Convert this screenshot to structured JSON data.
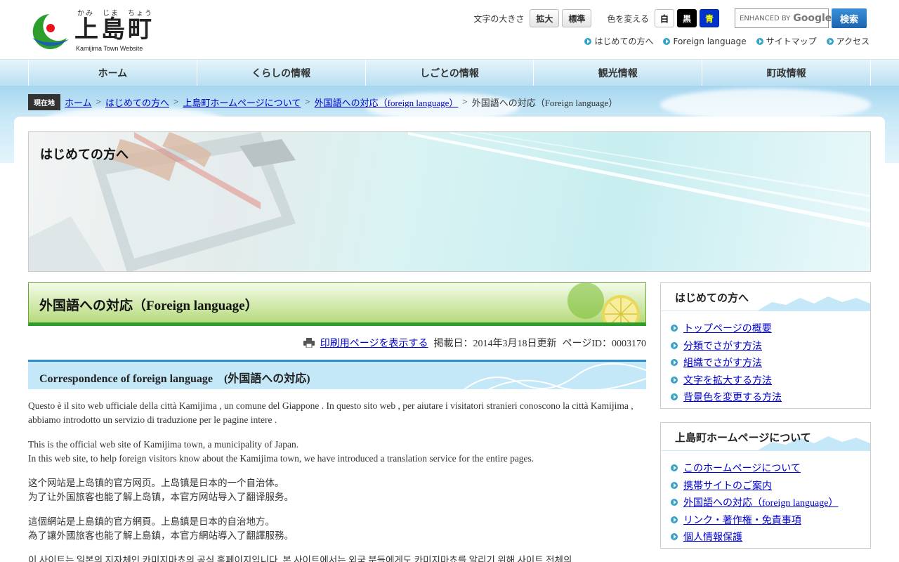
{
  "logo": {
    "ruby": "かみ　じま　ちょう",
    "name": "上島町",
    "subtitle": "Kamijima Town Website"
  },
  "tools": {
    "font_size_label": "文字の大きさ",
    "enlarge": "拡大",
    "standard": "標準",
    "color_label": "色を変える",
    "white": "白",
    "black": "黒",
    "blue": "青",
    "search_enhanced": "ENHANCED BY",
    "search_brand": "Google",
    "search_button": "検索"
  },
  "util_links": [
    "はじめての方へ",
    "Foreign language",
    "サイトマップ",
    "アクセス"
  ],
  "nav": [
    "ホーム",
    "くらしの情報",
    "しごとの情報",
    "観光情報",
    "町政情報"
  ],
  "breadcrumb": {
    "badge": "現在地",
    "links": [
      "ホーム",
      "はじめての方へ",
      "上島町ホームページについて",
      "外国語への対応（foreign language）"
    ],
    "separator": ">",
    "current": "外国語への対応（Foreign language）"
  },
  "hero": {
    "title": "はじめての方へ"
  },
  "page": {
    "title": "外国語への対応（Foreign language）",
    "print_link": "印刷用ページを表示する",
    "posted": "掲載日：2014年3月18日更新",
    "page_id": "ページID：0003170",
    "section_heading": "Correspondence of foreign language　(外国語への対応)",
    "paragraphs": [
      [
        "Questo è il sito web ufficiale della città Kamijima , un comune del Giappone . In questo sito web , per aiutare i visitatori stranieri conoscono la città Kamijima , abbiamo introdotto un servizio di traduzione per le pagine intere ."
      ],
      [
        "This is the official web site of Kamijima town, a municipality of Japan.",
        "In this web site, to help foreign visitors know about the Kamijima town, we have introduced a translation service for the entire pages."
      ],
      [
        "这个网站是上岛镇的官方网页。上岛镇是日本的一个自治体。",
        "为了让外国旅客也能了解上岛镇，本官方网站导入了翻译服务。"
      ],
      [
        "這個網站是上島鎮的官方網頁。上島鎮是日本的自治地方。",
        "為了讓外國旅客也能了解上島鎮，本官方網站導入了翻譯服務。"
      ],
      [
        "이 사이트는 일본의 지자체인 카미지마쵸의 공식 홈페이지입니다. 본 사이트에서는 외국 분들에게도 카미지마쵸를 알리기 위해 사이트 전체의"
      ]
    ]
  },
  "sidebar": [
    {
      "heading": "はじめての方へ",
      "items": [
        "トップページの概要",
        "分類でさがす方法",
        "組織でさがす方法",
        "文字を拡大する方法",
        "背景色を変更する方法"
      ]
    },
    {
      "heading": "上島町ホームページについて",
      "items": [
        "このホームページについて",
        "携帯サイトのご案内",
        "外国語への対応（foreign language）",
        "リンク・著作権・免責事項",
        "個人情報保護"
      ]
    }
  ],
  "colors": {
    "accent_blue": "#2b8dc9",
    "accent_green": "#2d9e2b",
    "link": "#0000cc"
  }
}
